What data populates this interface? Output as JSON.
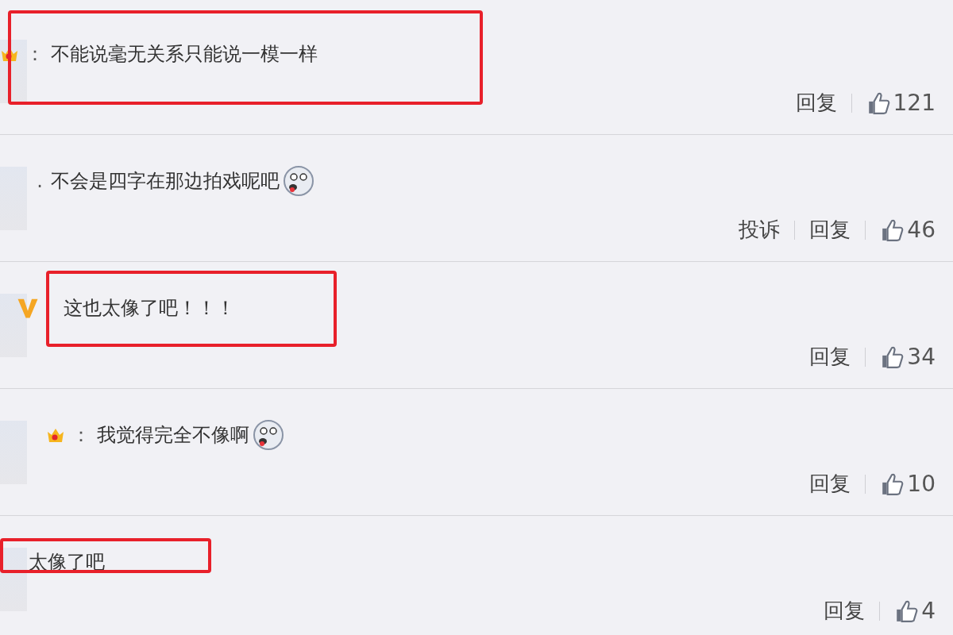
{
  "comments": [
    {
      "badge": {
        "kind": "crown"
      },
      "separator": "：",
      "text": "不能说毫无关系只能说一模一样",
      "emoji": false,
      "actions": [
        "回复"
      ],
      "likes": "121",
      "annotation": {
        "kind": "wide"
      }
    },
    {
      "separator": ".",
      "text": "不会是四字在那边拍戏呢吧",
      "emoji": true,
      "actions": [
        "投诉",
        "回复"
      ],
      "likes": "46"
    },
    {
      "badge": {
        "kind": "vip"
      },
      "text": "这也太像了吧！！！",
      "emoji": false,
      "actions": [
        "回复"
      ],
      "likes": "34",
      "annotation": {
        "kind": "box"
      }
    },
    {
      "badge": {
        "kind": "crown"
      },
      "separator": "：",
      "text": "我觉得完全不像啊",
      "emoji": true,
      "actions": [
        "回复"
      ],
      "likes": "10"
    },
    {
      "text": "太像了吧",
      "emoji": false,
      "actions": [
        "回复"
      ],
      "likes": "4",
      "annotation": {
        "kind": "strip"
      }
    }
  ]
}
